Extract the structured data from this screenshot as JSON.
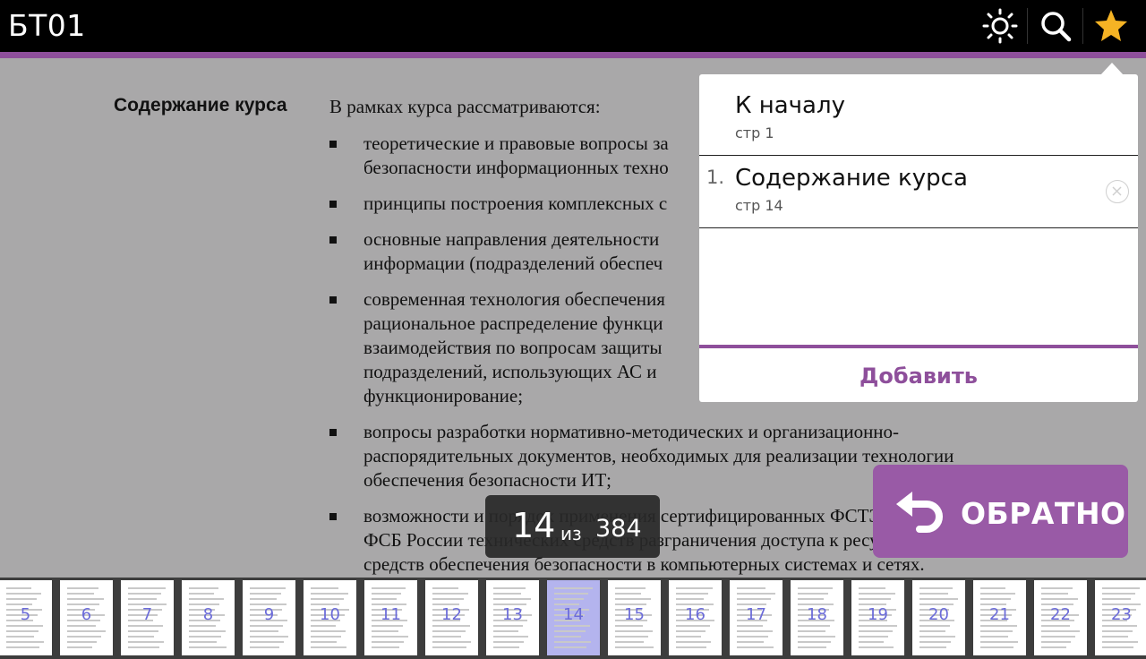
{
  "header": {
    "title": "БТ01",
    "icons": [
      "brightness-icon",
      "search-icon",
      "star-icon"
    ],
    "accent_color": "#8e4f9b"
  },
  "document": {
    "heading": "Содержание курса",
    "intro": "В рамках курса рассматриваются:",
    "bullets": [
      "теоретические и правовые вопросы за\nбезопасности информационных техно",
      "принципы построения комплексных с",
      "основные направления деятельности\nинформации (подразделений обеспеч",
      "современная технология обеспечения\nрациональное распределение функци\nвзаимодействия по вопросам защиты\nподразделений, использующих АС и\nфункционирование;",
      "вопросы разработки нормативно-методических и организационно-\nраспорядительных документов, необходимых для реализации технологии\nобеспечения безопасности ИТ;",
      "возможности и порядок применения сертифицированных ФСТЭК и\nФСБ России технических средств разграничения доступа к ресурсам АС и\nсредств обеспечения безопасности в компьютерных системах и сетях."
    ]
  },
  "bookmarks": {
    "items": [
      {
        "num": "",
        "title": "К началу",
        "page": "стр 1",
        "removable": false
      },
      {
        "num": "1.",
        "title": "Содержание курса",
        "page": "стр 14",
        "removable": true
      }
    ],
    "add_label": "Добавить"
  },
  "back_button": {
    "label": "ОБРАТНО"
  },
  "page_counter": {
    "current": "14",
    "of": "из",
    "total": "384"
  },
  "thumbnails": {
    "pages": [
      "5",
      "6",
      "7",
      "8",
      "9",
      "10",
      "11",
      "12",
      "13",
      "14",
      "15",
      "16",
      "17",
      "18",
      "19",
      "20",
      "21",
      "22",
      "23"
    ],
    "active": "14"
  }
}
